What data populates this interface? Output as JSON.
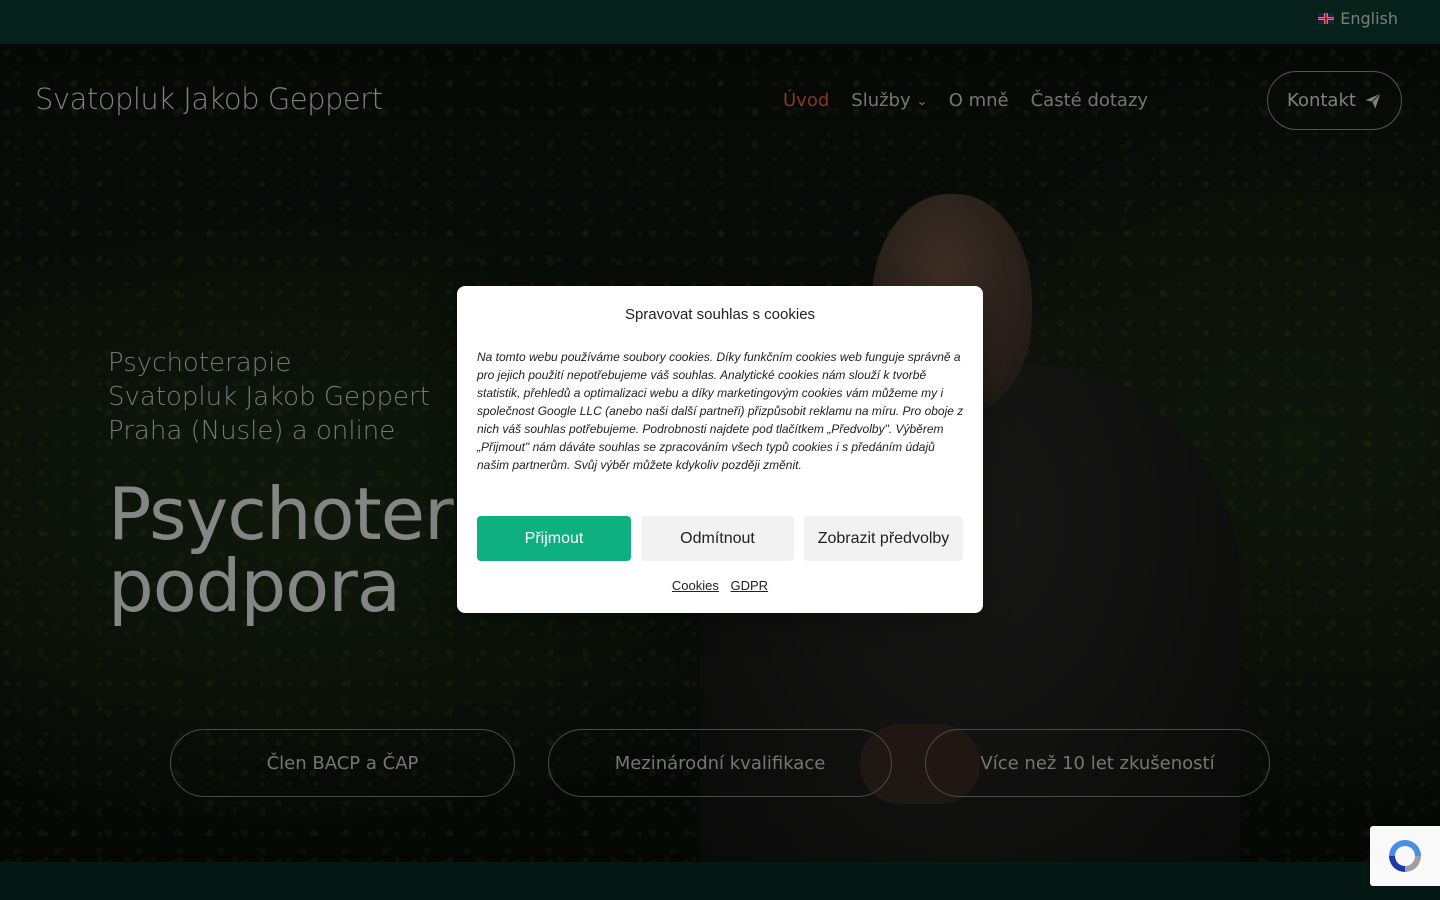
{
  "topbar": {
    "language_label": "English"
  },
  "header": {
    "logo": "Svatopluk Jakob Geppert",
    "nav": [
      {
        "label": "Úvod",
        "active": true
      },
      {
        "label": "Služby",
        "dropdown": true
      },
      {
        "label": "O mně"
      },
      {
        "label": "Časté dotazy"
      }
    ],
    "contact_button": "Kontakt"
  },
  "hero": {
    "subtitle_lines": [
      "Psychoterapie",
      "Svatopluk Jakob Geppert",
      "Praha (Nusle) a online"
    ],
    "title_lines": [
      "Psychotera",
      "podpora"
    ],
    "pills": [
      "Člen BACP a ČAP",
      "Mezinárodní kvalifikace",
      "Více než 10 let zkušeností"
    ]
  },
  "cookie_modal": {
    "title": "Spravovat souhlas s cookies",
    "body": "Na tomto webu používáme soubory cookies. Díky funkčním cookies web funguje správně a pro jejich použití nepotřebujeme váš souhlas. Analytické cookies nám slouží k tvorbě statistik, přehledů a optimalizaci webu a díky marketingovým cookies vám můžeme my i společnost Google LLC (anebo naši další partneři) přizpůsobit reklamu na míru. Pro oboje z nich váš souhlas potřebujeme. Podrobnosti najdete pod tlačítkem „Předvolby\". Výběrem „Přijmout\" nám dáváte souhlas se zpracováním všech typů cookies i s předáním údajů našim partnerům. Svůj výběr můžete kdykoliv později změnit.",
    "accept": "Přijmout",
    "deny": "Odmítnout",
    "preferences": "Zobrazit předvolby",
    "links": [
      "Cookies",
      "GDPR"
    ]
  },
  "colors": {
    "accent_active_nav": "#e0633a",
    "accept_button": "#0fb07f",
    "topbar_bg": "#0b3a2c"
  },
  "icons": {
    "language_flag": "uk-flag-icon",
    "dropdown": "chevron-down-icon",
    "contact": "paper-plane-icon",
    "recaptcha": "recaptcha-icon"
  }
}
